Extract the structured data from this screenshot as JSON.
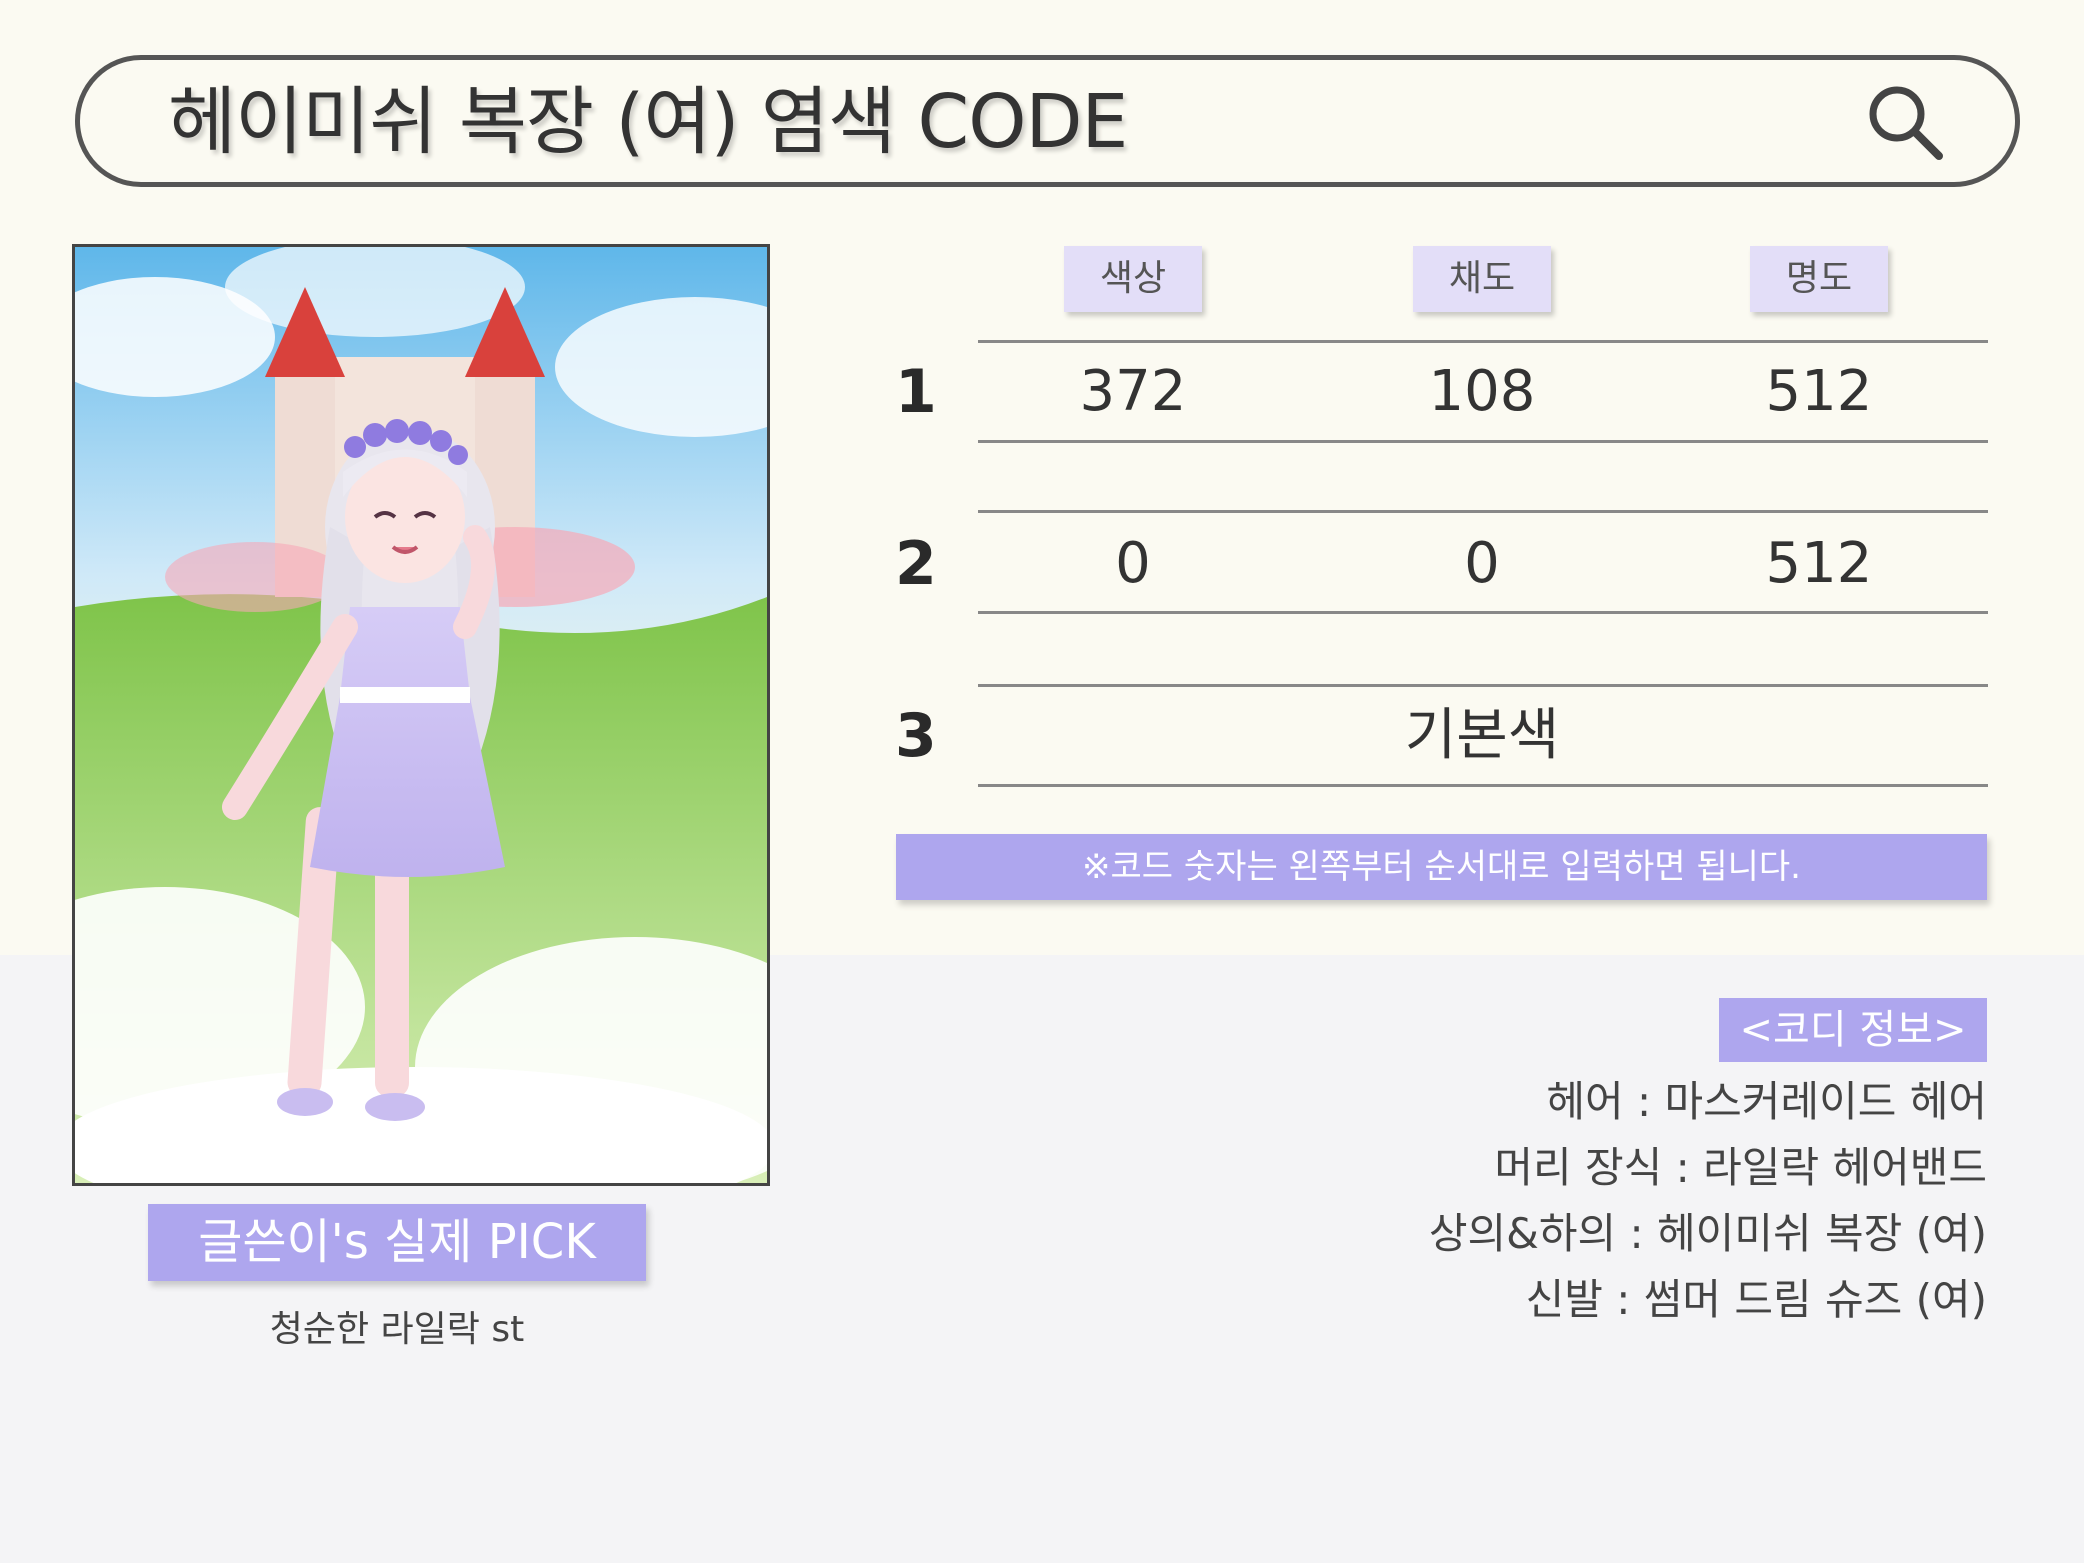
{
  "header": {
    "title": "헤이미쉬 복장 (여) 염색 CODE"
  },
  "pick": {
    "badge_label": "글쓴이's 실제 PICK",
    "caption": "청순한 라일락 st"
  },
  "code_table": {
    "columns": [
      "색상",
      "채도",
      "명도"
    ],
    "rows": [
      {
        "label": "1",
        "values": [
          "372",
          "108",
          "512"
        ]
      },
      {
        "label": "2",
        "values": [
          "0",
          "0",
          "512"
        ]
      },
      {
        "label": "3",
        "merged": "기본색"
      }
    ],
    "notice": "※코드 숫자는 왼쪽부터 순서대로 입력하면 됩니다."
  },
  "outfit_info": {
    "title": "<코디 정보>",
    "items": [
      "헤어 : 마스커레이드 헤어",
      "머리 장식 : 라일락 헤어밴드",
      "상의&하의 : 헤이미쉬 복장 (여)",
      "신발 : 썸머 드림 슈즈 (여)"
    ]
  },
  "colors": {
    "accent": "#aea6ee",
    "header_chip": "#e3def8",
    "page_top": "#fbfaf2",
    "page_bottom": "#f4f4f6",
    "outfit_lilac": "#c9bdf0",
    "hair": "#e8e6ee"
  },
  "icons": {
    "search": "search-icon"
  }
}
